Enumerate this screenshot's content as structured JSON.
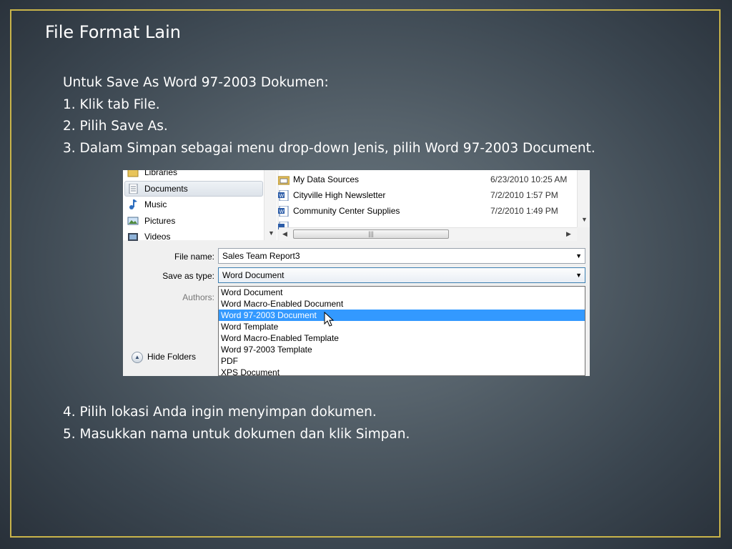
{
  "slide": {
    "title": "File Format Lain",
    "lines_top": [
      "Untuk Save As Word 97-2003 Dokumen:",
      "1. Klik tab File.",
      "2. Pilih Save As.",
      "3. Dalam Simpan sebagai menu drop-down Jenis, pilih Word 97-2003 Document."
    ],
    "lines_bottom": [
      "4. Pilih lokasi Anda ingin menyimpan dokumen.",
      "5. Masukkan nama untuk dokumen dan klik Simpan."
    ],
    "border_color": "#c9b44a"
  },
  "dialog": {
    "nav": [
      "Libraries",
      "Documents",
      "Music",
      "Pictures",
      "Videos"
    ],
    "nav_selected": "Documents",
    "files": [
      {
        "name": "My Data Sources",
        "date": "6/23/2010 10:25 AM"
      },
      {
        "name": "Cityville High Newsletter",
        "date": "7/2/2010 1:57 PM"
      },
      {
        "name": "Community Center Supplies",
        "date": "7/2/2010 1:49 PM"
      }
    ],
    "file_name_label": "File name:",
    "file_name_value": "Sales Team Report3",
    "save_type_label": "Save as type:",
    "save_type_value": "Word Document",
    "authors_label": "Authors:",
    "type_options": [
      "Word Document",
      "Word Macro-Enabled Document",
      "Word 97-2003 Document",
      "Word Template",
      "Word Macro-Enabled Template",
      "Word 97-2003 Template",
      "PDF",
      "XPS Document"
    ],
    "highlighted_option": "Word 97-2003 Document",
    "hide_folders_label": "Hide Folders",
    "highlight_color": "#3399ff"
  }
}
